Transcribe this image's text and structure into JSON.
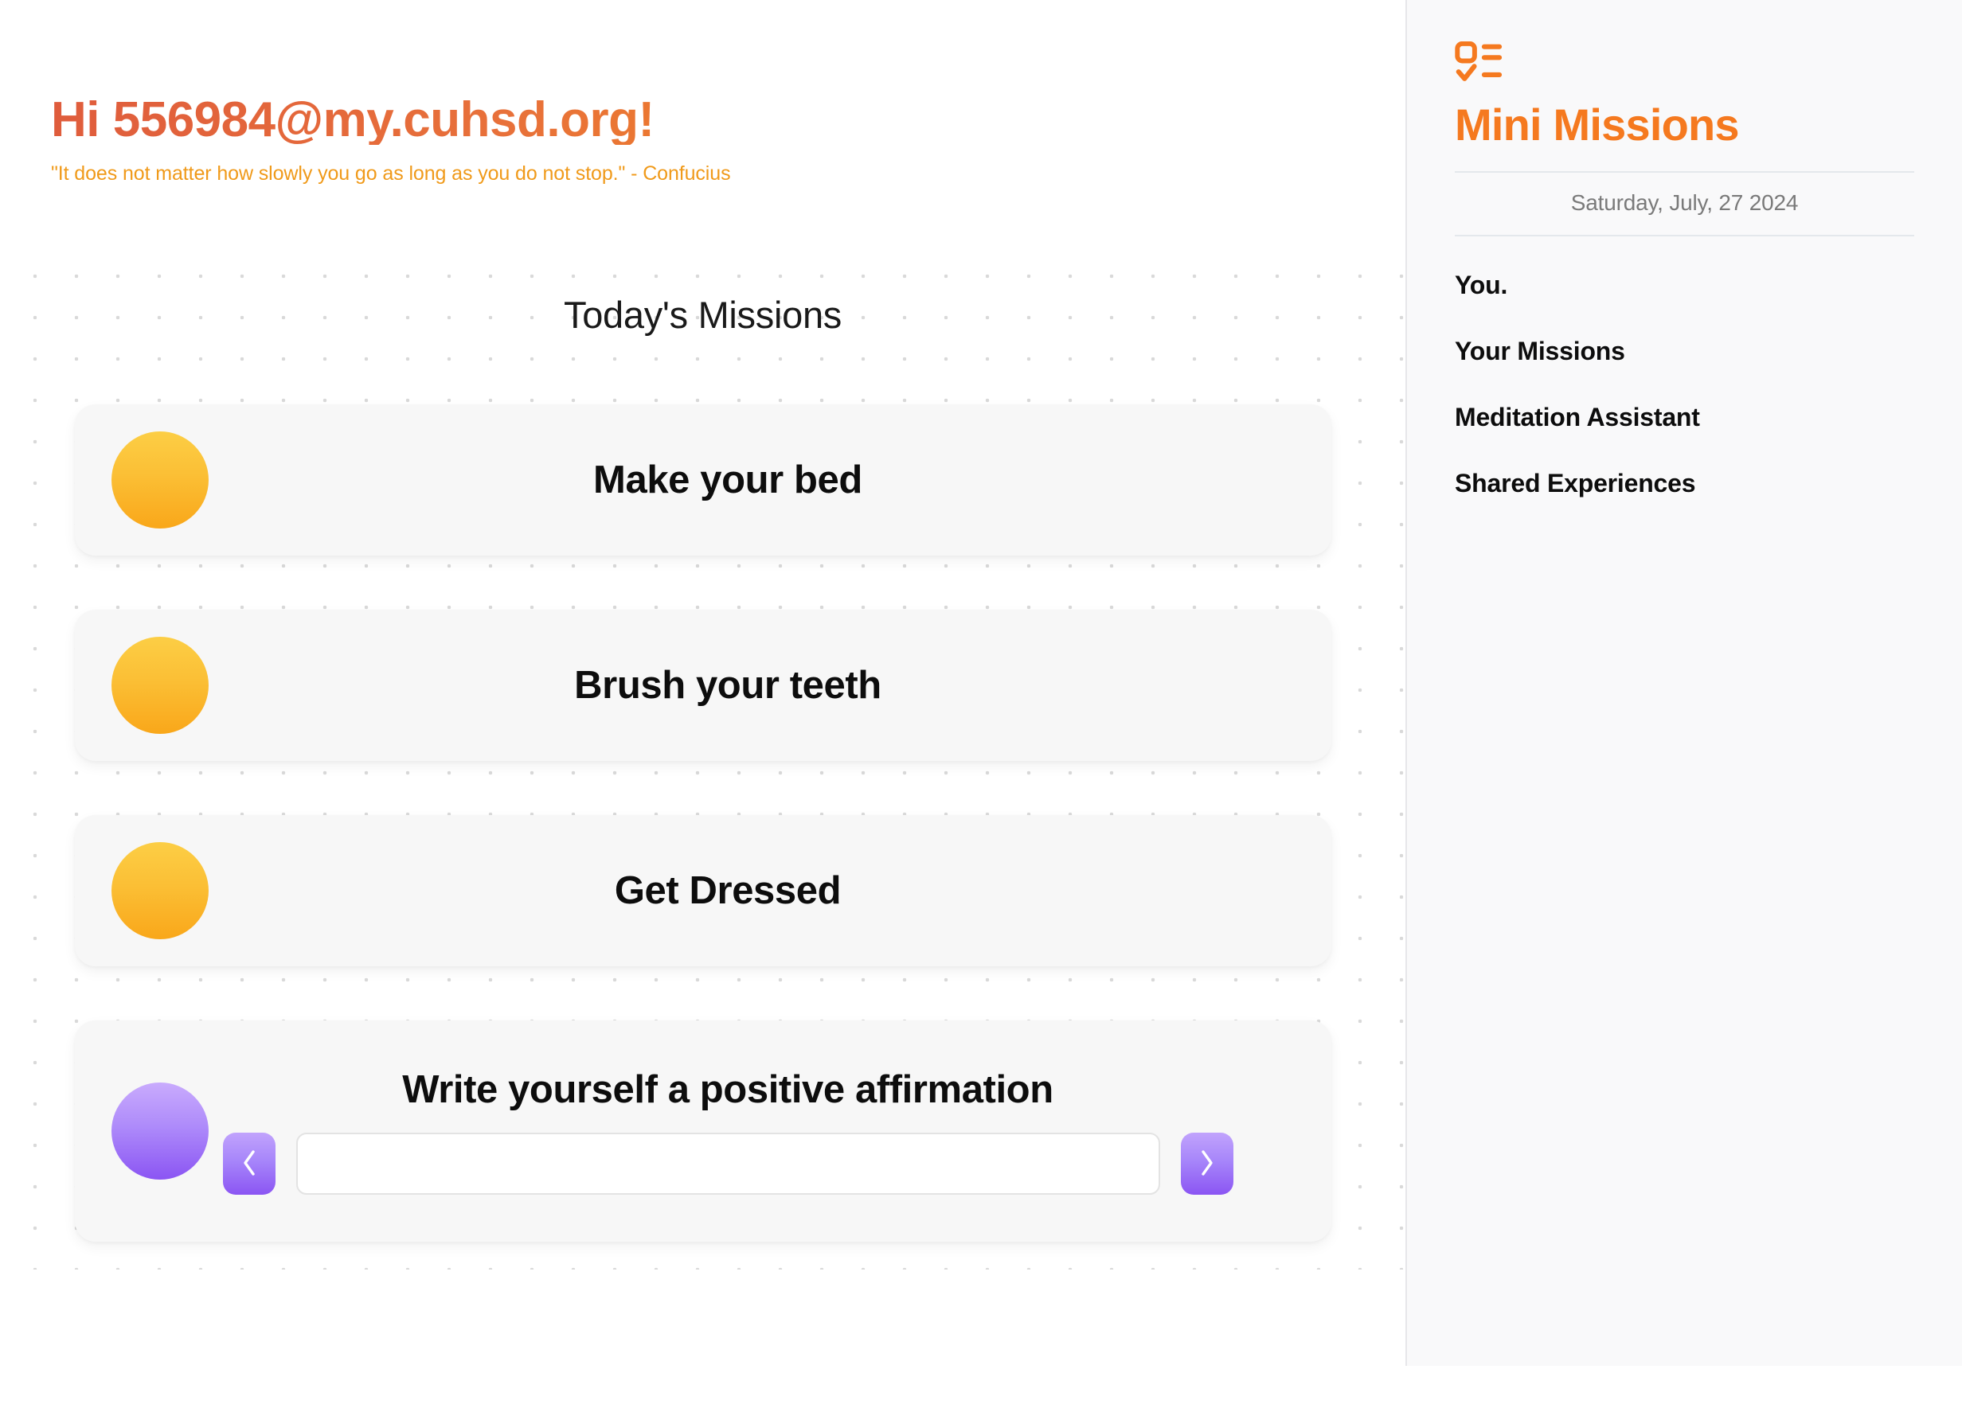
{
  "theme": {
    "accent_orange": "#f5791f",
    "greeting_gradient_start": "#df5c3c",
    "greeting_gradient_end": "#f59a14",
    "quote_color": "#f09a1a",
    "bullet_orange_top": "#fcce45",
    "bullet_orange_bottom": "#f9a71a",
    "bullet_purple_top": "#c9abfd",
    "bullet_purple_bottom": "#8b55f3",
    "card_bg": "#f7f7f7",
    "sidebar_bg": "#f9f9fa"
  },
  "main": {
    "greeting": "Hi 556984@my.cuhsd.org!",
    "quote": "\"It does not matter how slowly you go as long as you do not stop.\" - Confucius",
    "section_title": "Today's Missions",
    "missions": [
      {
        "title": "Make your bed",
        "bullet_color": "orange",
        "has_input": false
      },
      {
        "title": "Brush your teeth",
        "bullet_color": "orange",
        "has_input": false
      },
      {
        "title": "Get Dressed",
        "bullet_color": "orange",
        "has_input": false
      },
      {
        "title": "Write yourself a positive affirmation",
        "bullet_color": "purple",
        "has_input": true
      }
    ],
    "affirmation": {
      "value": "",
      "placeholder": "",
      "prev_label": "‹",
      "next_label": "›"
    }
  },
  "sidebar": {
    "logo_icon": "list-checks-icon",
    "brand_title": "Mini Missions",
    "date": "Saturday, July, 27 2024",
    "nav_items": [
      {
        "label": "You."
      },
      {
        "label": "Your Missions"
      },
      {
        "label": "Meditation Assistant"
      },
      {
        "label": "Shared Experiences"
      }
    ]
  }
}
